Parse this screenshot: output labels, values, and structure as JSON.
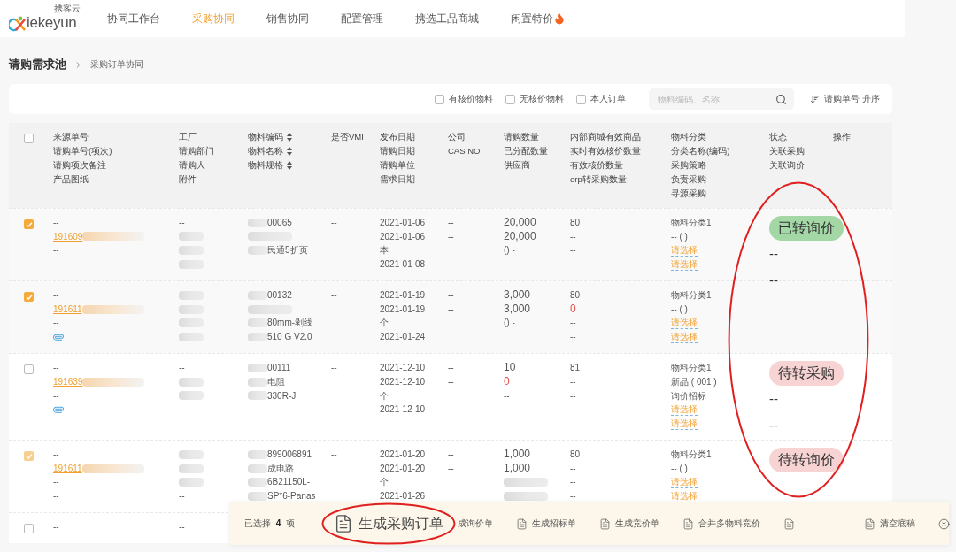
{
  "logo": {
    "name": "iekeyun",
    "tagline": "携客云"
  },
  "nav": [
    {
      "label": "协同工作台",
      "selected": false,
      "hot": false
    },
    {
      "label": "采购协同",
      "selected": true,
      "hot": false
    },
    {
      "label": "销售协同",
      "selected": false,
      "hot": false
    },
    {
      "label": "配置管理",
      "selected": false,
      "hot": false
    },
    {
      "label": "携选工品商城",
      "selected": false,
      "hot": false
    },
    {
      "label": "闲置特价",
      "selected": false,
      "hot": true
    }
  ],
  "breadcrumb": {
    "title": "请购需求池",
    "current": "采购订单协同"
  },
  "filters": [
    {
      "label": "有核价物料",
      "checked": false
    },
    {
      "label": "无核价物料",
      "checked": false
    },
    {
      "label": "本人订单",
      "checked": false
    }
  ],
  "search": {
    "placeholder": "物料编码、名称"
  },
  "sort": {
    "label": "请购单号 升序"
  },
  "header_checkbox": {
    "checked": false
  },
  "columns": [
    {
      "kind": "plain",
      "lines": [
        "来源单号",
        "请购单号(项次)",
        "请购项次备注",
        "产品图纸"
      ]
    },
    {
      "kind": "plain",
      "lines": [
        "工厂",
        "请购部门",
        "请购人",
        "附件"
      ]
    },
    {
      "kind": "sortable",
      "lines": [
        "物料编码",
        "物料名称",
        "物料规格"
      ]
    },
    {
      "kind": "plain",
      "lines": [
        "是否VMI"
      ]
    },
    {
      "kind": "plain",
      "lines": [
        "发布日期",
        "请购日期",
        "请购单位",
        "需求日期"
      ]
    },
    {
      "kind": "plain",
      "lines": [
        "公司",
        "CAS NO"
      ]
    },
    {
      "kind": "plain",
      "lines": [
        "请购数量",
        "已分配数量",
        "供应商"
      ]
    },
    {
      "kind": "plain",
      "lines": [
        "内部商城有效商品",
        "实时有效核价数量",
        "有效核价数量",
        "erp转采购数量"
      ]
    },
    {
      "kind": "plain",
      "lines": [
        "物料分类",
        "分类名称(编码)",
        "采购策略",
        "负责采购",
        "寻源采购"
      ]
    },
    {
      "kind": "plain",
      "lines": [
        "状态",
        "关联采购",
        "关联询价"
      ]
    },
    {
      "kind": "plain",
      "lines": [
        "操作"
      ]
    }
  ],
  "rows": [
    {
      "checked": true,
      "disabled": false,
      "cells": [
        [
          {
            "kind": "text",
            "text": "--"
          },
          {
            "kind": "link",
            "text": "191609"
          },
          {
            "kind": "text",
            "text": "--"
          },
          {
            "kind": "text",
            "text": "--"
          }
        ],
        [
          {
            "kind": "text",
            "text": "--"
          },
          {
            "kind": "redacted"
          },
          {
            "kind": "redacted"
          },
          {
            "kind": "redacted"
          }
        ],
        [
          {
            "kind": "partial",
            "text": "00065"
          },
          {
            "kind": "redacted"
          },
          {
            "kind": "partial",
            "text": "民通5折页"
          }
        ],
        [
          {
            "kind": "text",
            "text": "--"
          }
        ],
        [
          {
            "kind": "text",
            "text": "2021-01-06"
          },
          {
            "kind": "text",
            "text": "2021-01-06"
          },
          {
            "kind": "text",
            "text": "本"
          },
          {
            "kind": "text",
            "text": "2021-01-08"
          }
        ],
        [
          {
            "kind": "text",
            "text": "--"
          },
          {
            "kind": "text",
            "text": "--"
          }
        ],
        [
          {
            "kind": "figure",
            "text": "20,000"
          },
          {
            "kind": "figure",
            "text": "20,000"
          },
          {
            "kind": "text",
            "text": "() -"
          }
        ],
        [
          {
            "kind": "text",
            "text": "80"
          },
          {
            "kind": "text",
            "text": "--"
          },
          {
            "kind": "text",
            "text": "--"
          },
          {
            "kind": "text",
            "text": "--"
          }
        ],
        [
          {
            "kind": "text",
            "text": "物料分类1"
          },
          {
            "kind": "text",
            "text": "-- ( )"
          },
          {
            "kind": "picker",
            "text": "请选择"
          },
          {
            "kind": "picker",
            "text": "请选择"
          }
        ],
        [
          {
            "kind": "done_badge",
            "text": "已转询价"
          },
          {
            "kind": "big",
            "text": "--"
          },
          {
            "kind": "big",
            "text": "--"
          }
        ]
      ]
    },
    {
      "checked": true,
      "disabled": false,
      "cells": [
        [
          {
            "kind": "text",
            "text": "--"
          },
          {
            "kind": "link",
            "text": "191611"
          },
          {
            "kind": "text",
            "text": "--"
          },
          {
            "kind": "attachment"
          }
        ],
        [
          {
            "kind": "redacted"
          },
          {
            "kind": "redacted"
          },
          {
            "kind": "redacted"
          },
          {
            "kind": "redacted"
          }
        ],
        [
          {
            "kind": "partial",
            "text": "00132"
          },
          {
            "kind": "redacted"
          },
          {
            "kind": "partial",
            "text": "80mm-剥线"
          },
          {
            "kind": "partial",
            "text": "510 G V2.0"
          }
        ],
        [
          {
            "kind": "text",
            "text": "--"
          }
        ],
        [
          {
            "kind": "text",
            "text": "2021-01-19"
          },
          {
            "kind": "text",
            "text": "2021-01-19"
          },
          {
            "kind": "text",
            "text": "个"
          },
          {
            "kind": "text",
            "text": "2021-01-24"
          }
        ],
        [
          {
            "kind": "text",
            "text": "--"
          },
          {
            "kind": "text",
            "text": "--"
          }
        ],
        [
          {
            "kind": "figure",
            "text": "3,000"
          },
          {
            "kind": "figure",
            "text": "3,000"
          },
          {
            "kind": "text",
            "text": "() -"
          }
        ],
        [
          {
            "kind": "text",
            "text": "80"
          },
          {
            "kind": "alert",
            "text": "0"
          },
          {
            "kind": "text",
            "text": "--"
          },
          {
            "kind": "text",
            "text": "--"
          }
        ],
        [
          {
            "kind": "text",
            "text": "物料分类1"
          },
          {
            "kind": "text",
            "text": "-- ( )"
          },
          {
            "kind": "picker",
            "text": "请选择"
          },
          {
            "kind": "picker",
            "text": "请选择"
          }
        ]
      ]
    },
    {
      "checked": false,
      "disabled": false,
      "cells": [
        [
          {
            "kind": "text",
            "text": "--"
          },
          {
            "kind": "link",
            "text": "191639"
          },
          {
            "kind": "text",
            "text": "--"
          },
          {
            "kind": "attachment"
          }
        ],
        [
          {
            "kind": "text",
            "text": "--"
          },
          {
            "kind": "redacted"
          },
          {
            "kind": "redacted"
          },
          {
            "kind": "text",
            "text": "--"
          }
        ],
        [
          {
            "kind": "partial",
            "text": "00111"
          },
          {
            "kind": "partial",
            "text": "电阻"
          },
          {
            "kind": "partial",
            "text": "330R-J"
          }
        ],
        [
          {
            "kind": "text",
            "text": "--"
          }
        ],
        [
          {
            "kind": "text",
            "text": "2021-12-10"
          },
          {
            "kind": "text",
            "text": "2021-12-10"
          },
          {
            "kind": "text",
            "text": "个"
          },
          {
            "kind": "text",
            "text": "2021-12-10"
          }
        ],
        [
          {
            "kind": "text",
            "text": "--"
          },
          {
            "kind": "text",
            "text": "--"
          }
        ],
        [
          {
            "kind": "figure",
            "text": "10"
          },
          {
            "kind": "alert",
            "text": "0"
          },
          {
            "kind": "text",
            "text": "--"
          }
        ],
        [
          {
            "kind": "text",
            "text": "81"
          },
          {
            "kind": "text",
            "text": "--"
          },
          {
            "kind": "text",
            "text": "--"
          },
          {
            "kind": "text",
            "text": "--"
          }
        ],
        [
          {
            "kind": "text",
            "text": "物料分类1"
          },
          {
            "kind": "text",
            "text": "新品 ( 001 )"
          },
          {
            "kind": "text",
            "text": "询价招标"
          },
          {
            "kind": "picker",
            "text": "请选择"
          },
          {
            "kind": "picker",
            "text": "请选择"
          }
        ],
        [
          {
            "kind": "pending_badge",
            "text": "待转采购"
          },
          {
            "kind": "big",
            "text": "--"
          },
          {
            "kind": "big",
            "text": "--"
          }
        ]
      ]
    },
    {
      "checked": true,
      "disabled": true,
      "cells": [
        [
          {
            "kind": "text",
            "text": "--"
          },
          {
            "kind": "link",
            "text": "191611"
          },
          {
            "kind": "text",
            "text": "--"
          },
          {
            "kind": "text",
            "text": "--"
          }
        ],
        [
          {
            "kind": "redacted"
          },
          {
            "kind": "redacted"
          },
          {
            "kind": "redacted"
          },
          {
            "kind": "text",
            "text": "--"
          }
        ],
        [
          {
            "kind": "partial",
            "text": "899006891"
          },
          {
            "kind": "partial",
            "text": "成电路"
          },
          {
            "kind": "partial",
            "text": "6B21150L-"
          },
          {
            "kind": "partial",
            "text": "SP*6-Panas"
          }
        ],
        [
          {
            "kind": "text",
            "text": "--"
          }
        ],
        [
          {
            "kind": "text",
            "text": "2021-01-20"
          },
          {
            "kind": "text",
            "text": "2021-01-20"
          },
          {
            "kind": "text",
            "text": "个"
          },
          {
            "kind": "text",
            "text": "2021-01-26"
          }
        ],
        [
          {
            "kind": "text",
            "text": "--"
          },
          {
            "kind": "text",
            "text": "--"
          }
        ],
        [
          {
            "kind": "figure",
            "text": "1,000"
          },
          {
            "kind": "figure",
            "text": "1,000"
          },
          {
            "kind": "redacted"
          },
          {
            "kind": "redacted"
          }
        ],
        [
          {
            "kind": "text",
            "text": "80"
          },
          {
            "kind": "text",
            "text": "--"
          },
          {
            "kind": "text",
            "text": "--"
          },
          {
            "kind": "text",
            "text": "--"
          }
        ],
        [
          {
            "kind": "text",
            "text": "物料分类1"
          },
          {
            "kind": "text",
            "text": "-- ( )"
          },
          {
            "kind": "picker",
            "text": "请选择"
          },
          {
            "kind": "picker",
            "text": "请选择"
          }
        ],
        [
          {
            "kind": "pending_badge",
            "text": "待转询价"
          }
        ]
      ]
    },
    {
      "checked": false,
      "disabled": false,
      "cells": [
        [
          {
            "kind": "text",
            "text": "--"
          }
        ],
        [
          {
            "kind": "text",
            "text": "--"
          }
        ]
      ]
    }
  ],
  "action_bar": {
    "selection": "已选择 **4** 项",
    "actions": [
      {
        "kind": "primary",
        "label": "生成采购订单"
      },
      {
        "kind": "bare",
        "label": "成询价单"
      },
      {
        "kind": "action",
        "label": "生成招标单"
      },
      {
        "kind": "action",
        "label": "生成竞价单"
      },
      {
        "kind": "action",
        "label": "合并多物料竞价"
      },
      {
        "kind": "icon_only"
      },
      {
        "kind": "action",
        "label": "清空底稿"
      },
      {
        "kind": "close"
      }
    ]
  },
  "annotations": {
    "status_ellipse": true,
    "action_ellipse": true
  }
}
